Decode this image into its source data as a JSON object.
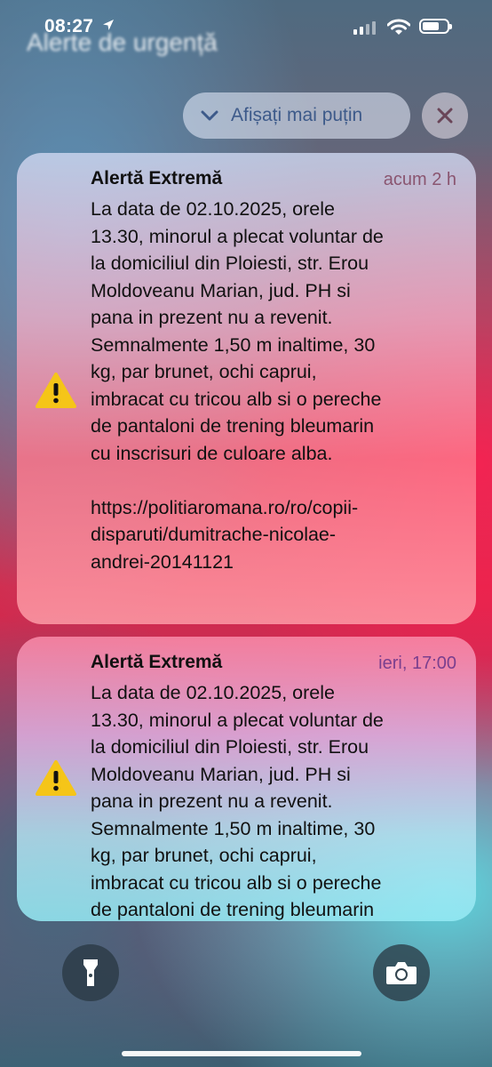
{
  "status_bar": {
    "time": "08:27",
    "icons": [
      "location-arrow-icon",
      "signal-icon",
      "wifi-icon",
      "battery-icon"
    ]
  },
  "screen_title": "Alerte de urgență",
  "controls": {
    "show_less_label": "Afișați mai puțin",
    "close_icon": "close-icon"
  },
  "alerts": [
    {
      "title": "Alertă Extremă",
      "time": "acum 2 h",
      "icon": "warning-icon",
      "body": "La data de 02.10.2025, orele\n13.30, minorul a plecat voluntar de\nla domiciliul din Ploiesti, str. Erou\nMoldoveanu Marian, jud. PH si\npana in prezent nu a revenit.\nSemnalmente 1,50 m inaltime, 30\nkg, par brunet, ochi caprui,\nimbracat cu tricou alb si o pereche\nde pantaloni de trening bleumarin\ncu inscrisuri de culoare alba.\n\nhttps://politiaromana.ro/ro/copii-\ndisparuti/dumitrache-nicolae-\nandrei-20141121"
    },
    {
      "title": "Alertă Extremă",
      "time": "ieri, 17:00",
      "icon": "warning-icon",
      "body": "La data de 02.10.2025, orele\n13.30, minorul a plecat voluntar de\nla domiciliul din Ploiesti, str. Erou\nMoldoveanu Marian, jud. PH si\npana in prezent nu a revenit.\nSemnalmente 1,50 m inaltime, 30\nkg, par brunet, ochi caprui,\nimbracat cu tricou alb si o pereche\nde pantaloni de trening bleumarin"
    }
  ],
  "bottom_controls": [
    "flashlight-icon",
    "camera-icon"
  ],
  "colors": {
    "warning_yellow": "#f5c518",
    "show_less_text": "#3d5a8a"
  }
}
